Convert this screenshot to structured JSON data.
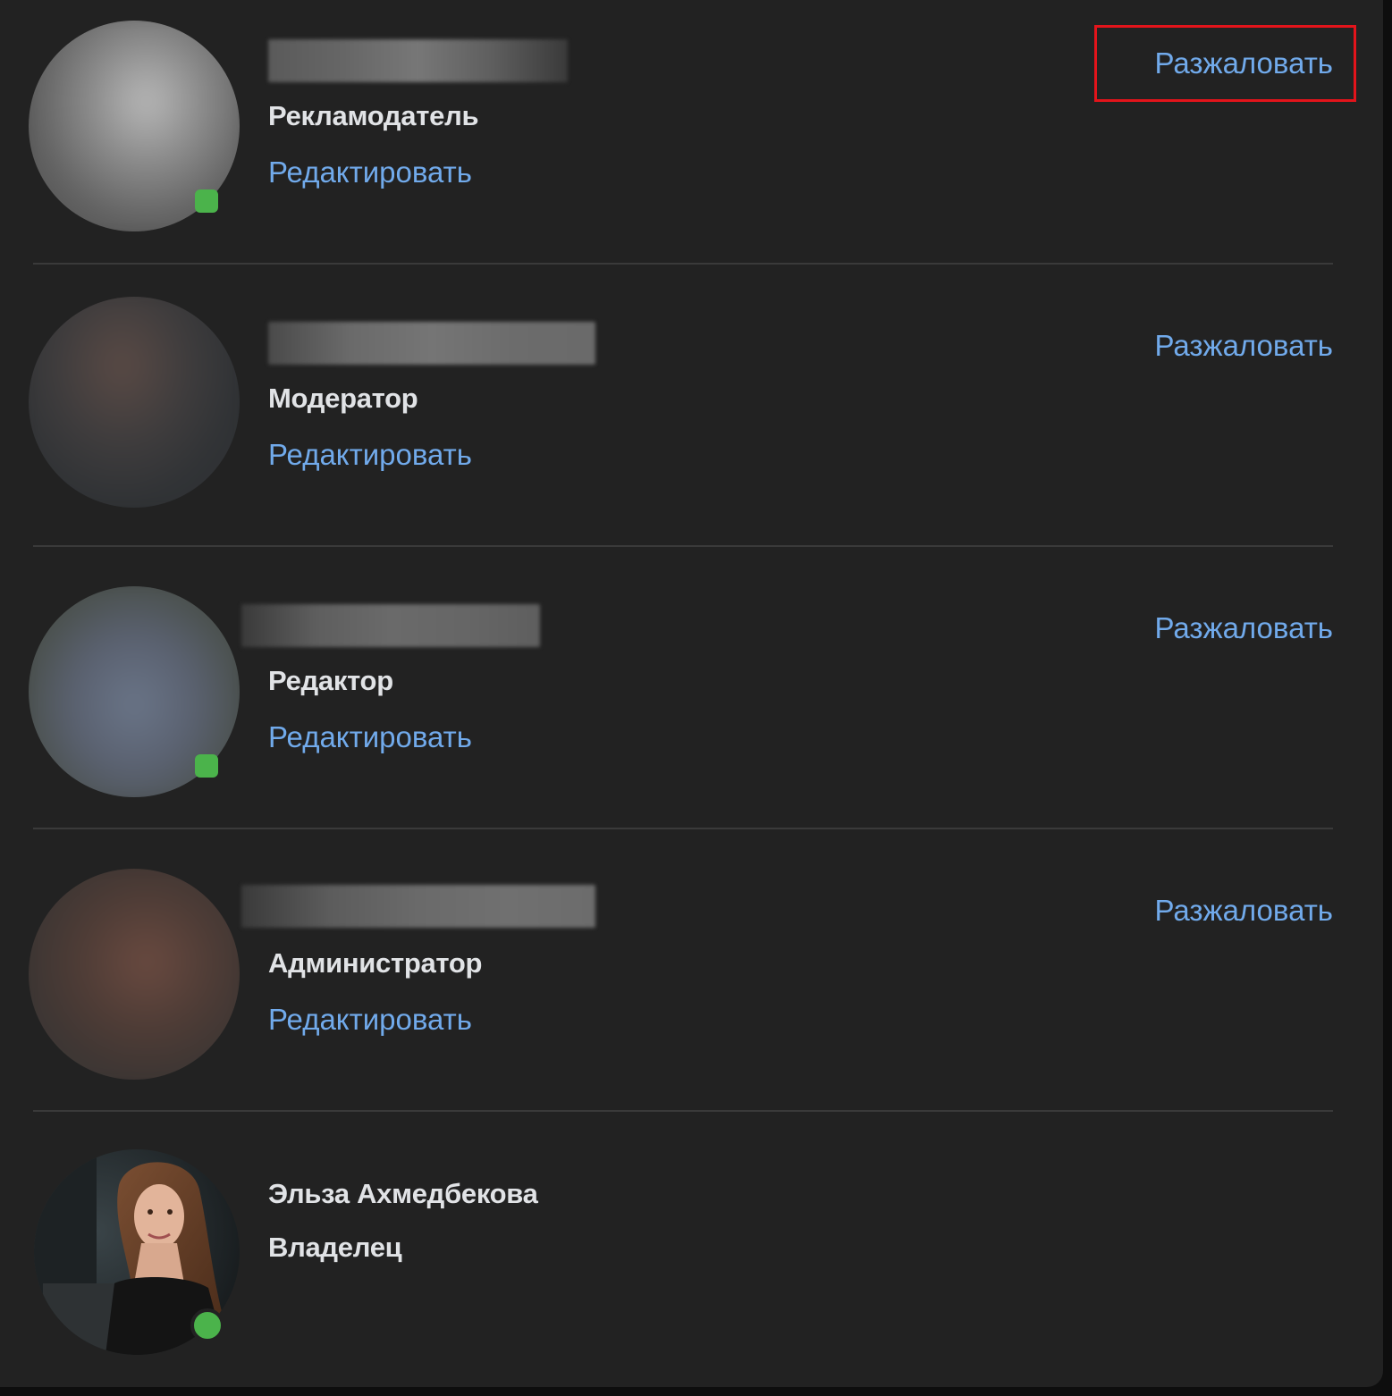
{
  "managers": [
    {
      "role": "Рекламодатель",
      "edit_label": "Редактировать",
      "demote_label": "Разжаловать"
    },
    {
      "role": "Модератор",
      "edit_label": "Редактировать",
      "demote_label": "Разжаловать"
    },
    {
      "role": "Редактор",
      "edit_label": "Редактировать",
      "demote_label": "Разжаловать"
    },
    {
      "role": "Администратор",
      "edit_label": "Редактировать",
      "demote_label": "Разжаловать"
    }
  ],
  "owner": {
    "name": "Эльза Ахмедбекова",
    "role": "Владелец"
  },
  "colors": {
    "background": "#222222",
    "link": "#71aaeb",
    "text": "#e1e3e6",
    "online": "#4bb34b",
    "highlight": "#e3141b",
    "divider": "#3a3a3a"
  }
}
